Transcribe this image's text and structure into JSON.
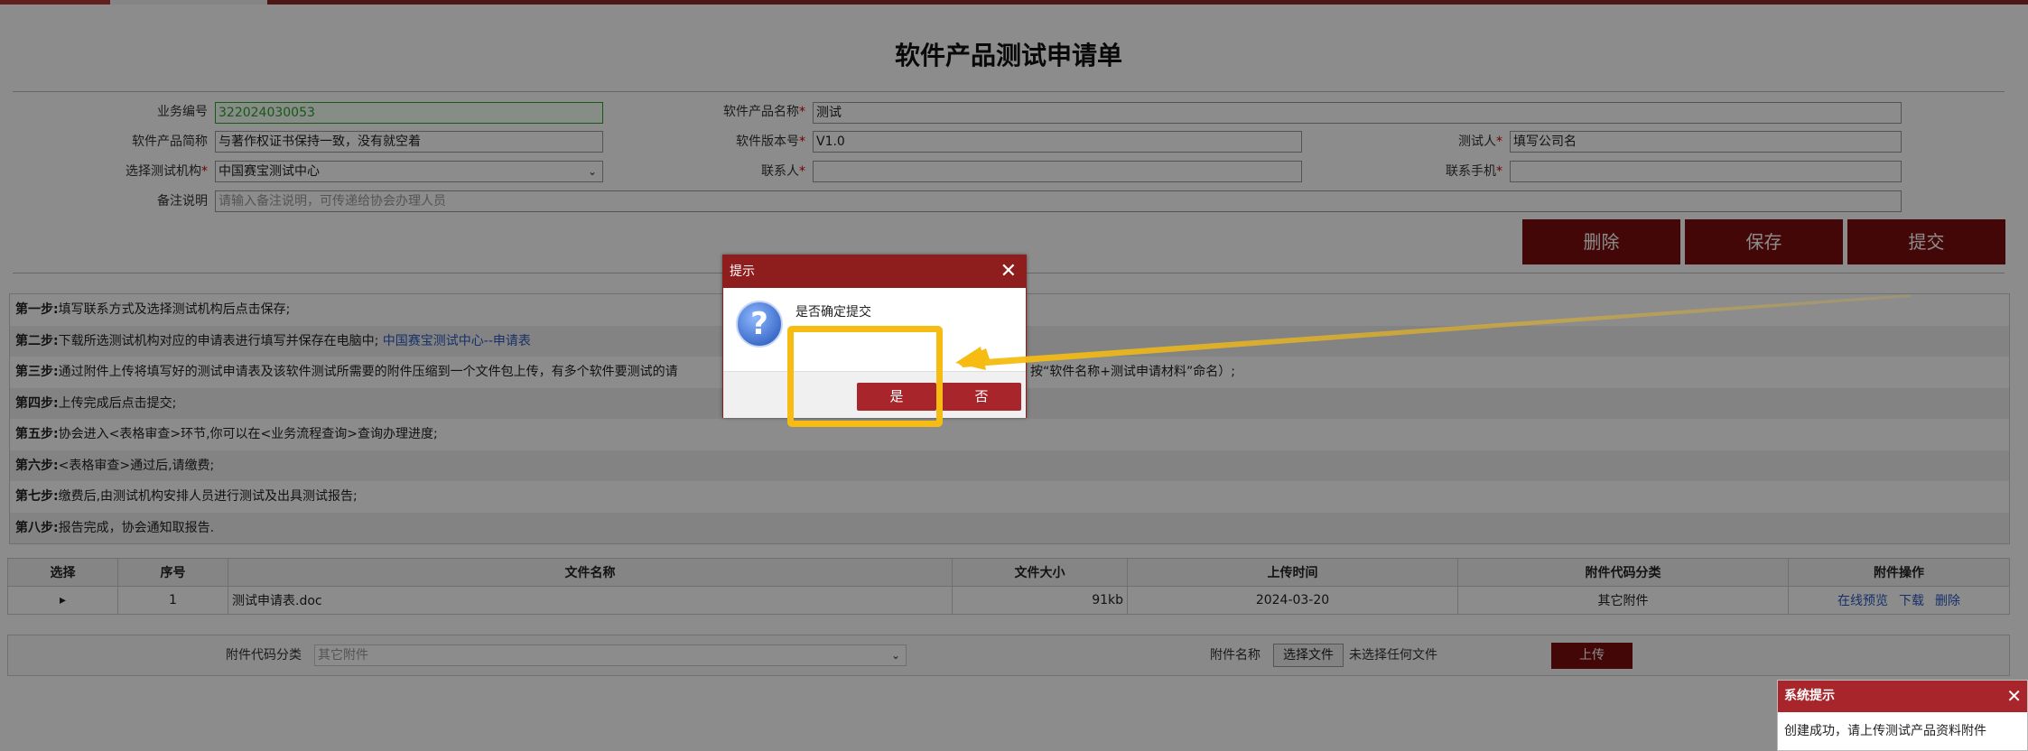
{
  "page": {
    "title": "软件产品测试申请单"
  },
  "form": {
    "business_no_label": "业务编号",
    "business_no_value": "322024030053",
    "product_name_label": "软件产品名称",
    "product_name_value": "测试",
    "short_name_label": "软件产品简称",
    "short_name_value": "与著作权证书保持一致，没有就空着",
    "version_label": "软件版本号",
    "version_value": "V1.0",
    "tester_label": "测试人",
    "tester_value": "填写公司名",
    "org_label": "选择测试机构",
    "org_value": "中国赛宝测试中心",
    "contact_label": "联系人",
    "contact_value": "",
    "phone_label": "联系手机",
    "phone_value": "",
    "remark_label": "备注说明",
    "remark_placeholder": "请输入备注说明，可传递给协会办理人员",
    "required_mark": "*"
  },
  "actions": {
    "delete": "删除",
    "save": "保存",
    "submit": "提交"
  },
  "steps": [
    {
      "label": "第一步:",
      "text": "填写联系方式及选择测试机构后点击保存;"
    },
    {
      "label": "第二步:",
      "text": "下载所选测试机构对应的申请表进行填写并保存在电脑中;",
      "link": "中国赛宝测试中心--申请表"
    },
    {
      "label": "第三步:",
      "text": "通过附件上传将填写好的测试申请表及该软件测试所需要的附件压缩到一个文件包上传，有多个软件要测试的请",
      "tail": "按“软件名称+测试申请材料”命名）;"
    },
    {
      "label": "第四步:",
      "text": "上传完成后点击提交;"
    },
    {
      "label": "第五步:",
      "text": "协会进入<表格审查>环节,你可以在<业务流程查询>查询办理进度;"
    },
    {
      "label": "第六步:",
      "text": "<表格审查>通过后,请缴费;"
    },
    {
      "label": "第七步:",
      "text": "缴费后,由测试机构安排人员进行测试及出具测试报告;"
    },
    {
      "label": "第八步:",
      "text": "报告完成，协会通知取报告."
    }
  ],
  "table": {
    "headers": [
      "选择",
      "序号",
      "文件名称",
      "文件大小",
      "上传时间",
      "附件代码分类",
      "附件操作"
    ],
    "rows": [
      {
        "select": "▸",
        "index": "1",
        "name": "测试申请表.doc",
        "size": "91kb",
        "time": "2024-03-20",
        "category": "其它附件",
        "ops": [
          "在线预览",
          "下载",
          "删除"
        ]
      }
    ]
  },
  "upload": {
    "category_label": "附件代码分类",
    "category_value": "其它附件",
    "name_label": "附件名称",
    "choose_button": "选择文件",
    "no_file": "未选择任何文件",
    "upload_button": "上传"
  },
  "dialog": {
    "title": "提示",
    "close": "✕",
    "icon": "?",
    "message": "是否确定提交",
    "yes": "是",
    "no": "否"
  },
  "toast": {
    "title": "系统提示",
    "close": "✕",
    "message": "创建成功，请上传测试产品资料附件"
  },
  "colors": {
    "brand_dark": "#7a0e0e",
    "brand": "#a8252b",
    "highlight": "#f6bc12",
    "link": "#2a58c0",
    "field_ok": "#2ea02e"
  }
}
